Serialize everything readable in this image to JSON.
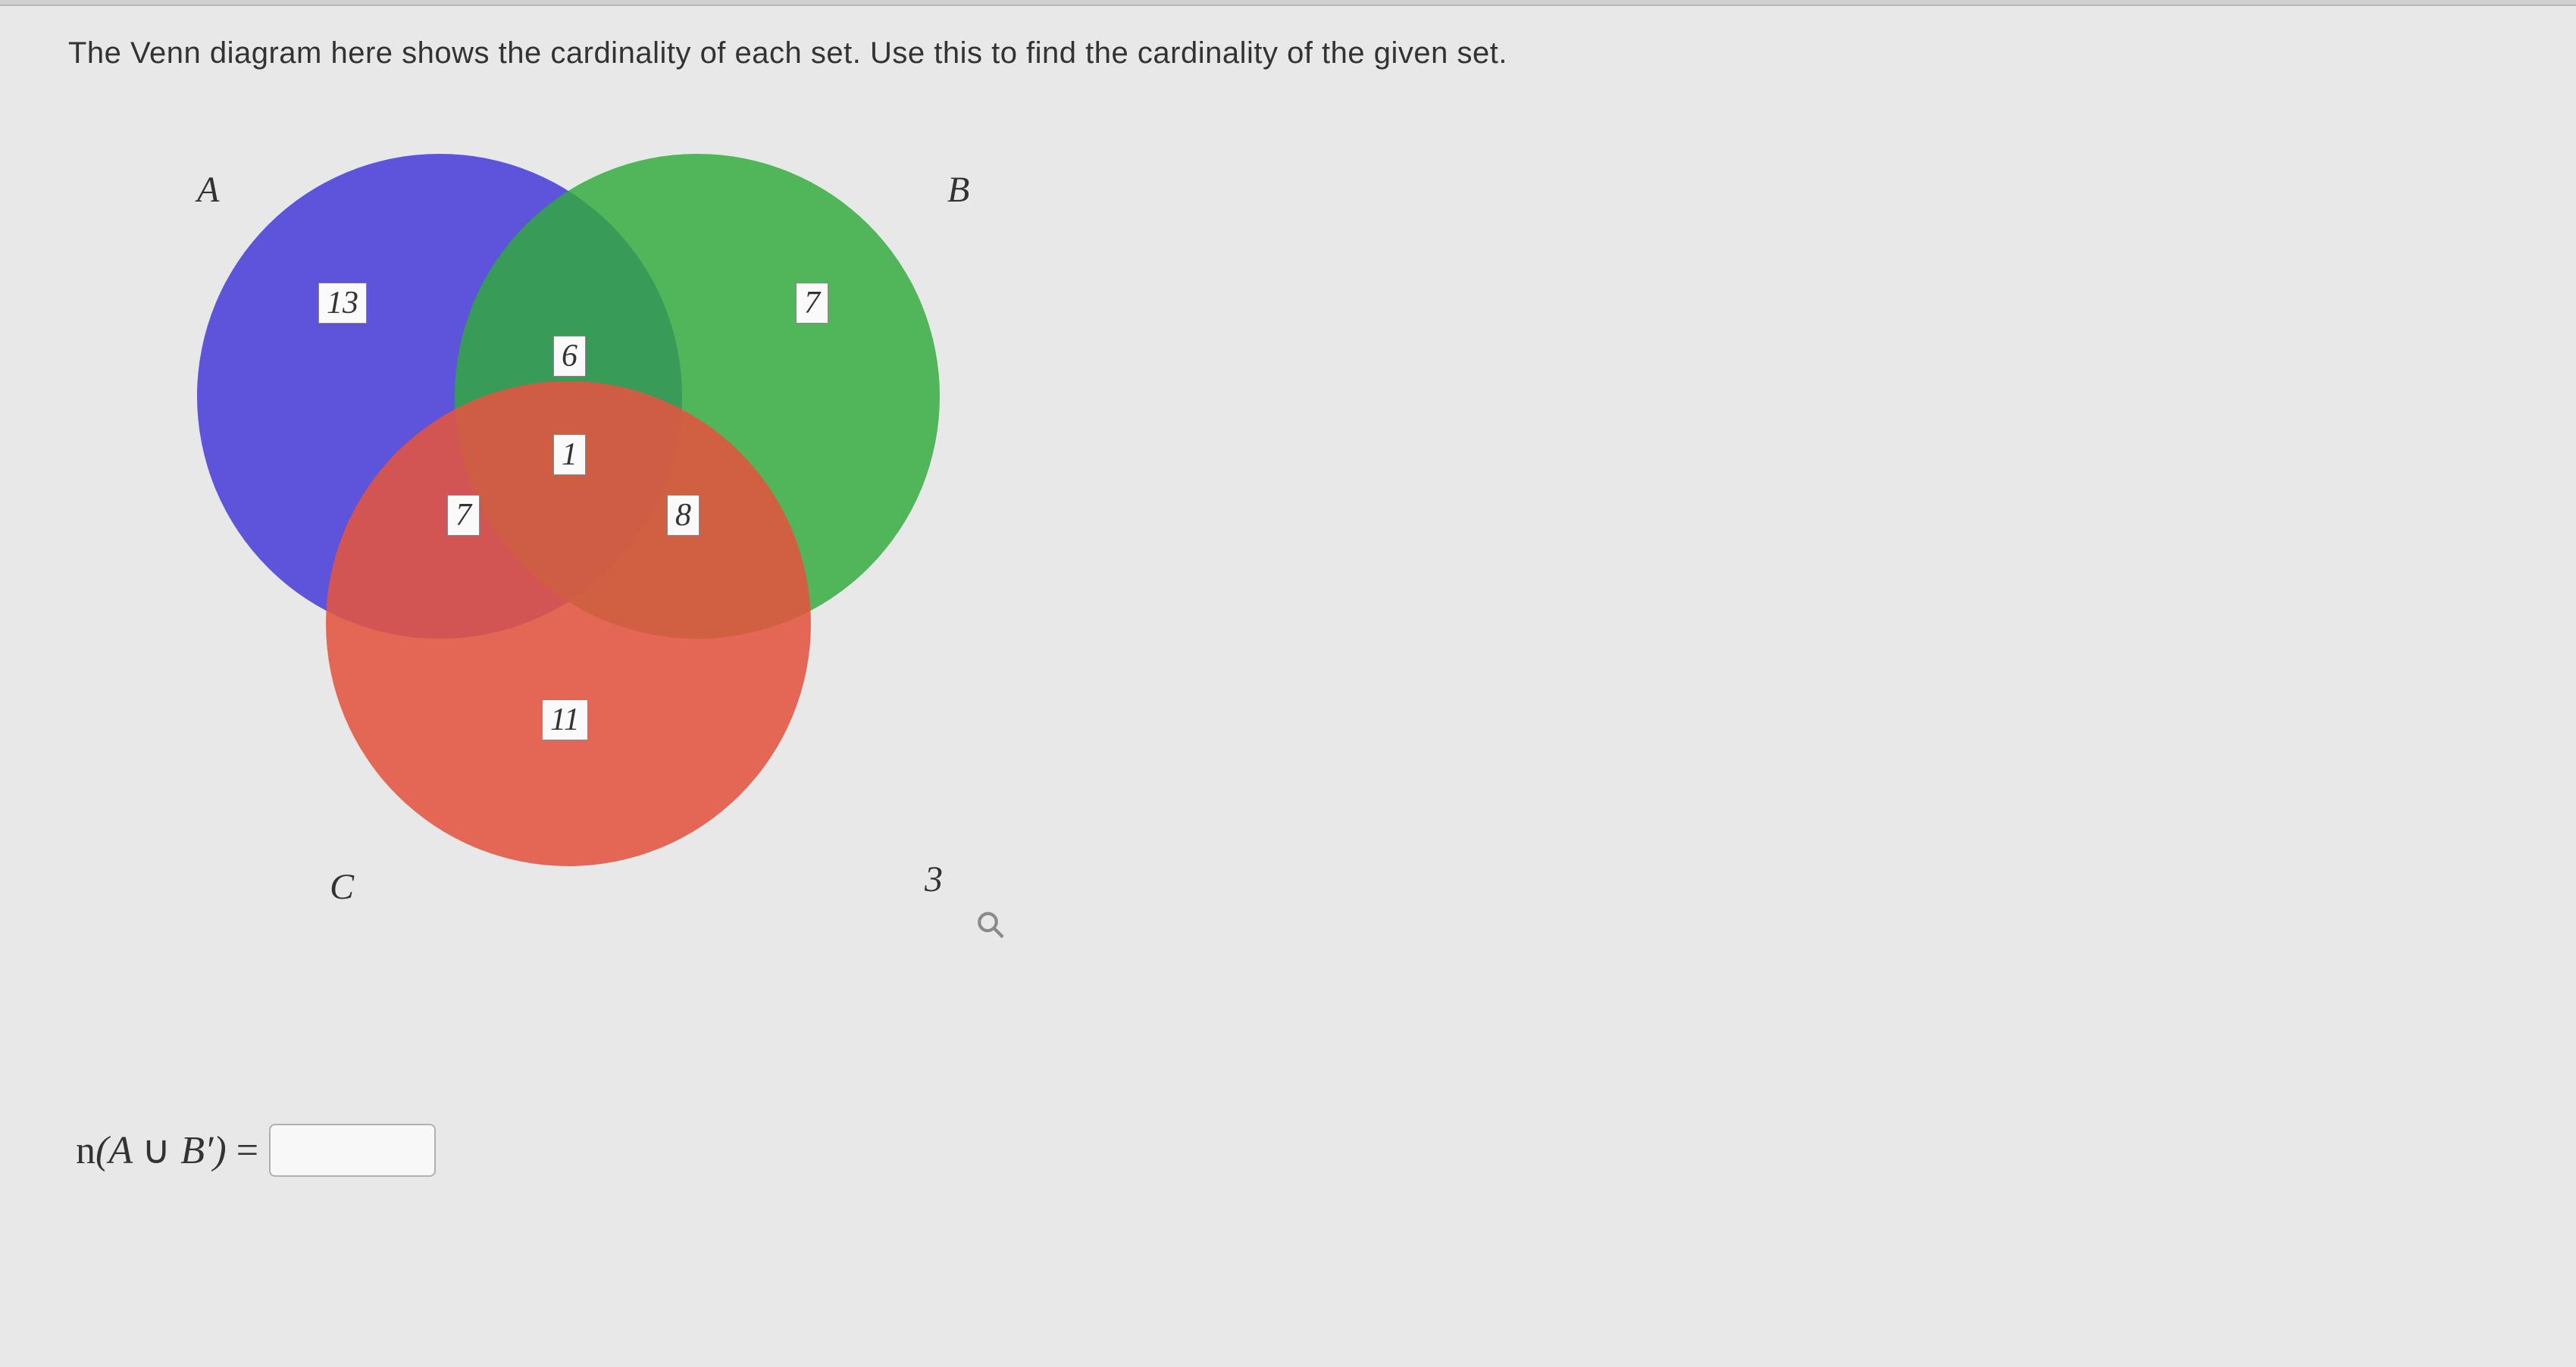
{
  "prompt": "The Venn diagram here shows the cardinality of each set. Use this to find the cardinality of the given set.",
  "labels": {
    "A": "A",
    "B": "B",
    "C": "C"
  },
  "regions": {
    "A_only": "13",
    "B_only": "7",
    "C_only": "11",
    "AB_only": "6",
    "AC_only": "7",
    "BC_only": "8",
    "ABC": "1",
    "outside": "3"
  },
  "question_expr": {
    "full": "n(A ∪ B′) ="
  },
  "answer_value": "",
  "chart_data": {
    "type": "venn3",
    "sets": [
      "A",
      "B",
      "C"
    ],
    "region_cardinalities": {
      "A∩B'∩C'": 13,
      "A'∩B∩C'": 7,
      "A'∩B'∩C": 11,
      "A∩B∩C'": 6,
      "A∩B'∩C": 7,
      "A'∩B∩C": 8,
      "A∩B∩C": 1,
      "A'∩B'∩C'": 3
    },
    "colors": {
      "A": "#4a3fd8",
      "B": "#2fab3a",
      "C": "#e25440"
    },
    "question": "n(A ∪ B')"
  }
}
